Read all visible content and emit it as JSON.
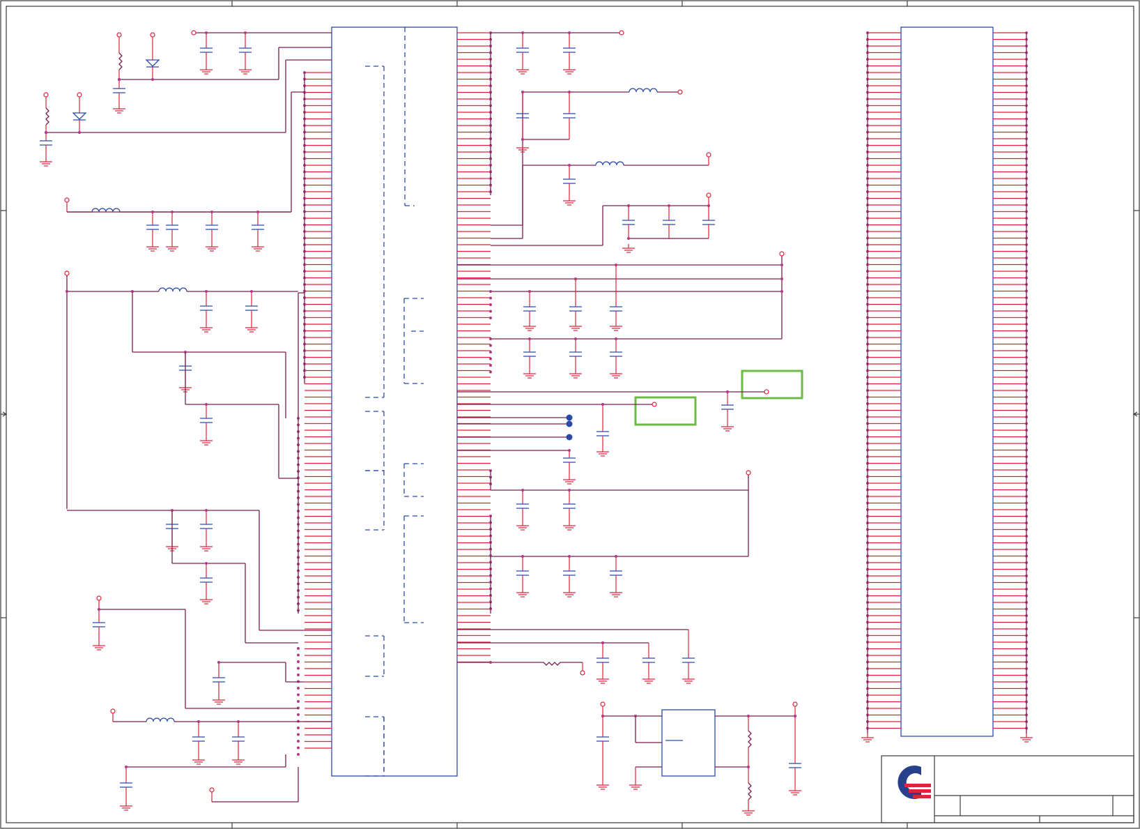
{
  "schematic": {
    "colors": {
      "wire": "#7a1f4d",
      "pin": "#e0203a",
      "component": "#2b4aa8",
      "frame": "#3a3a3a",
      "highlight": "#6dbb45",
      "logo_blue": "#27408b",
      "logo_red": "#d9263c"
    },
    "icons": [
      "schematic-sheet",
      "ic-symbol",
      "connector-symbol",
      "capacitor",
      "inductor",
      "resistor",
      "diode",
      "ground",
      "logo-mark"
    ],
    "highlights": 2,
    "title_block": {
      "logo": "logo-mark"
    }
  }
}
